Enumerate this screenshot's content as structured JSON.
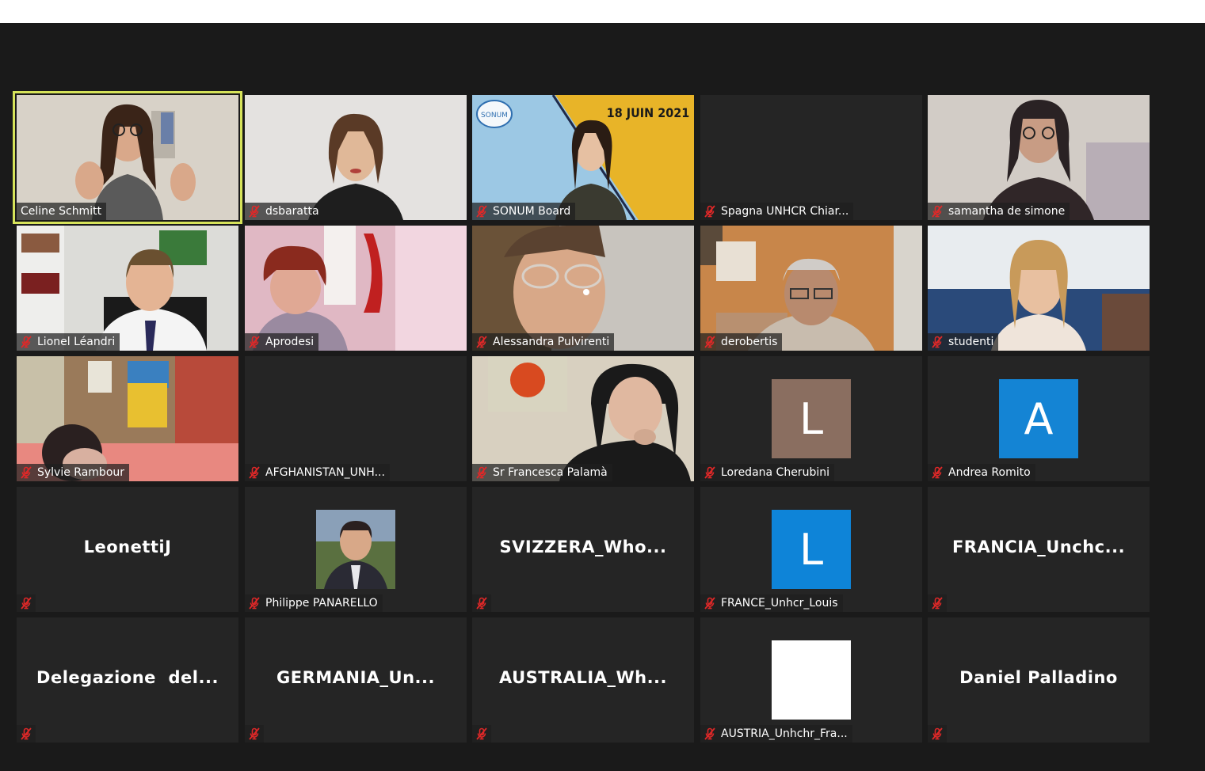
{
  "window": {
    "title": ""
  },
  "colors": {
    "active_border": "#d6e35a",
    "tile_bg": "#252525",
    "mute_icon": "#e02828"
  },
  "participants": [
    {
      "name": "Celine Schmitt",
      "muted": false,
      "active": true
    },
    {
      "name": "dsbaratta",
      "muted": true
    },
    {
      "name": "SONUM Board",
      "muted": true,
      "video_text": "18 JUIN 2021",
      "logo_text": "SONUM"
    },
    {
      "name": "Spagna UNHCR Chiar...",
      "muted": true
    },
    {
      "name": "samantha de simone",
      "muted": true
    },
    {
      "name": "Lionel Léandri",
      "muted": true
    },
    {
      "name": "Aprodesi",
      "muted": true
    },
    {
      "name": "Alessandra Pulvirenti",
      "muted": true
    },
    {
      "name": "derobertis",
      "muted": true
    },
    {
      "name": "studenti",
      "muted": true
    },
    {
      "name": "Sylvie Rambour",
      "muted": true
    },
    {
      "name": "AFGHANISTAN_UNH...",
      "muted": true
    },
    {
      "name": "Sr Francesca Palamà",
      "muted": true
    },
    {
      "name": "Loredana Cherubini",
      "muted": true,
      "avatar_letter": "L",
      "avatar_color": "#8a6e60"
    },
    {
      "name": "Andrea Romito",
      "muted": true,
      "avatar_letter": "A",
      "avatar_color": "#1484d4"
    },
    {
      "name": "",
      "display_name": "LeonettiJ",
      "muted": true
    },
    {
      "name": "Philippe PANARELLO",
      "muted": true
    },
    {
      "name": "",
      "display_name": "SVIZZERA_Who...",
      "muted": true
    },
    {
      "name": "FRANCE_Unhcr_Louis",
      "muted": true,
      "avatar_letter": "L",
      "avatar_color": "#0e84d8"
    },
    {
      "name": "",
      "display_name": "FRANCIA_Unchc...",
      "muted": true
    },
    {
      "name": "",
      "display_name": "Delegazione  del...",
      "muted": true
    },
    {
      "name": "",
      "display_name": "GERMANIA_Un...",
      "muted": true
    },
    {
      "name": "",
      "display_name": "AUSTRALIA_Wh...",
      "muted": true
    },
    {
      "name": "AUSTRIA_Unhchr_Fra...",
      "muted": true,
      "avatar_color": "#ffffff"
    },
    {
      "name": "",
      "display_name": "Daniel Palladino",
      "muted": true
    }
  ]
}
